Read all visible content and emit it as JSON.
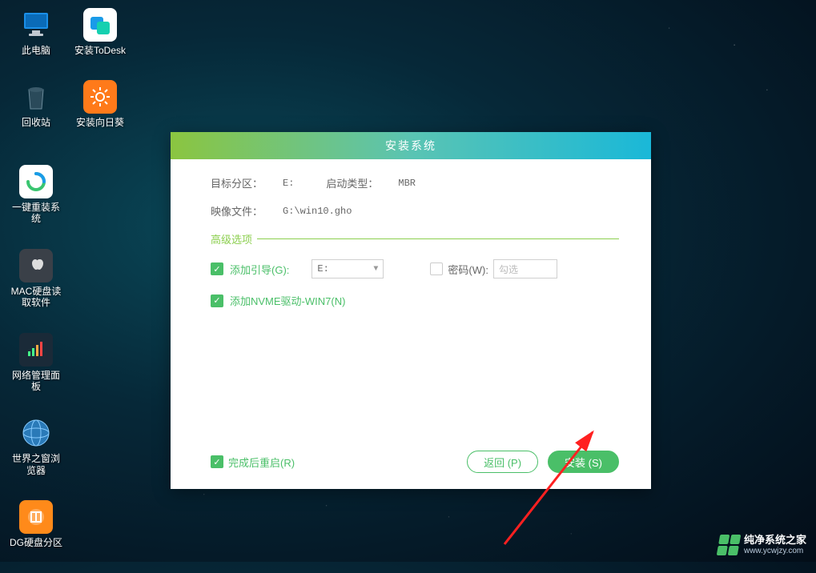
{
  "desktop": {
    "icons": [
      {
        "label": "此电脑"
      },
      {
        "label": "安装ToDesk"
      },
      {
        "label": "回收站"
      },
      {
        "label": "安装向日葵"
      },
      {
        "label": "一键重装系统"
      },
      {
        "label": "MAC硬盘读取软件"
      },
      {
        "label": "网络管理面板"
      },
      {
        "label": "世界之窗浏览器"
      },
      {
        "label": "DG硬盘分区"
      }
    ]
  },
  "dialog": {
    "title": "安装系统",
    "target_partition_label": "目标分区：",
    "target_partition_value": "E:",
    "boot_type_label": "启动类型：",
    "boot_type_value": "MBR",
    "image_file_label": "映像文件：",
    "image_file_value": "G:\\win10.gho",
    "advanced_legend": "高级选项",
    "add_boot_label": "添加引导(G):",
    "add_boot_select_value": "E:",
    "password_label": "密码(W):",
    "password_placeholder": "勾选",
    "add_nvme_label": "添加NVME驱动-WIN7(N)",
    "restart_after_label": "完成后重启(R)",
    "back_button": "返回 (P)",
    "install_button": "安装 (S)"
  },
  "watermark": {
    "title": "纯净系统之家",
    "url": "www.ycwjzy.com"
  },
  "colors": {
    "accent_green": "#4abf68",
    "gradient_start": "#8bc540",
    "gradient_end": "#1ab8d8"
  }
}
